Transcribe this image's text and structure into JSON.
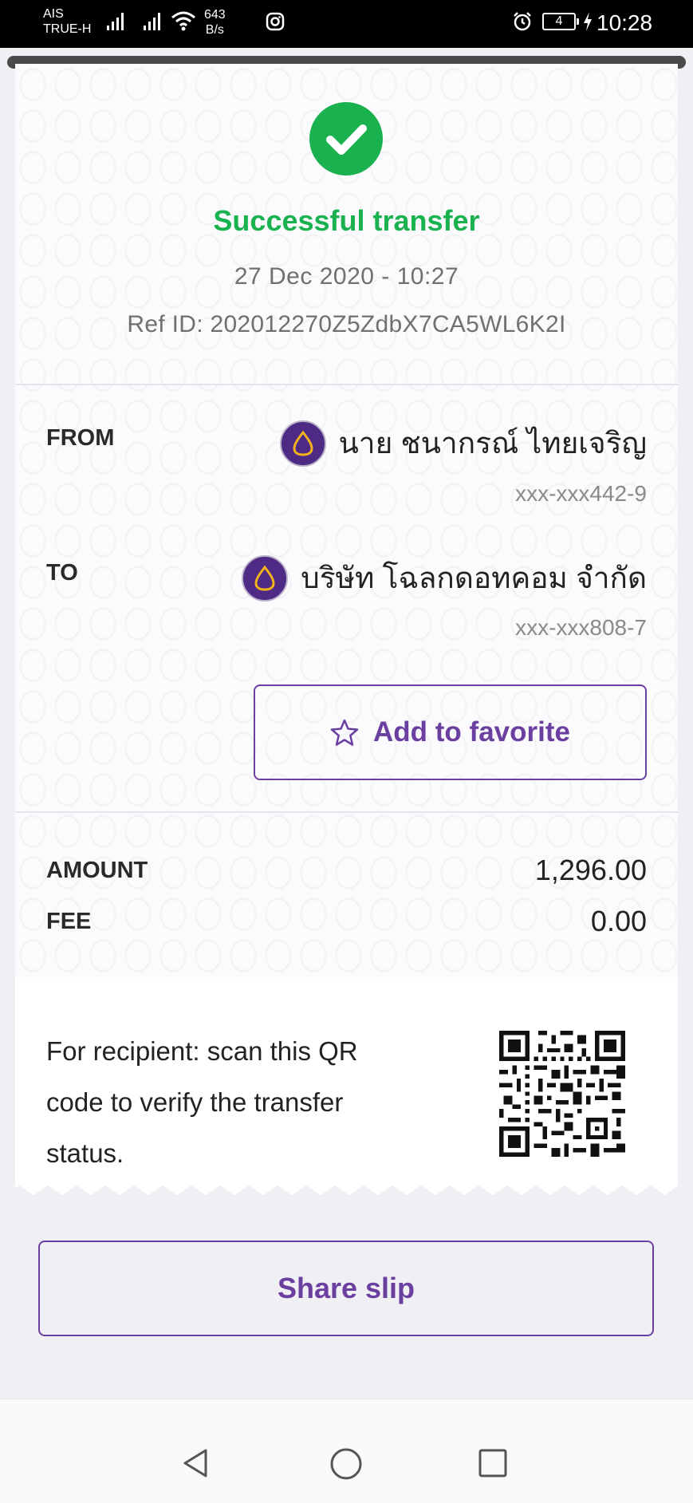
{
  "status_bar": {
    "carrier_1": "AIS",
    "carrier_2": "TRUE-H",
    "speed_value": "643",
    "speed_unit": "B/s",
    "battery": "4",
    "time": "10:28"
  },
  "receipt": {
    "title": "Successful transfer",
    "datetime": "27 Dec 2020 - 10:27",
    "ref_id": "Ref ID: 202012270Z5ZdbX7CA5WL6K2I",
    "from_label": "FROM",
    "from_name": "นาย ชนากรณ์ ไทยเจริญ",
    "from_account": "xxx-xxx442-9",
    "to_label": "TO",
    "to_name": "บริษัท โฉลกดอทคอม จำกัด",
    "to_account": "xxx-xxx808-7",
    "favorite_label": "Add to favorite",
    "amount_label": "AMOUNT",
    "amount_value": "1,296.00",
    "fee_label": "FEE",
    "fee_value": "0.00",
    "qr_text": "For recipient: scan this QR code to verify the transfer status."
  },
  "actions": {
    "share_label": "Share slip"
  },
  "colors": {
    "success": "#1ab24f",
    "brand_purple": "#6b3fa0",
    "bank_logo": "#4e2a84"
  }
}
